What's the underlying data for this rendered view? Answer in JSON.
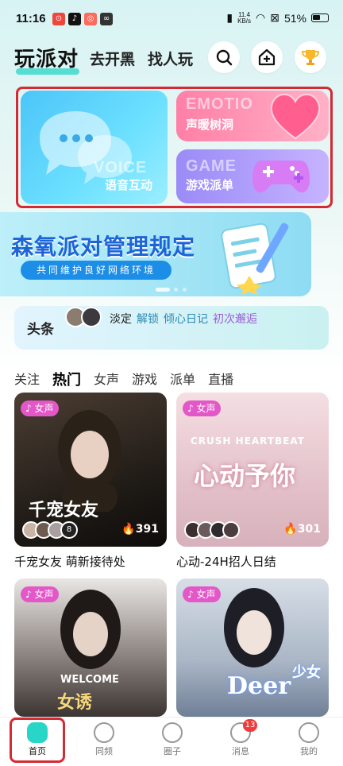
{
  "status_bar": {
    "time": "11:16",
    "speed_value": "11.4",
    "speed_unit": "KB/s",
    "battery": "51%"
  },
  "header": {
    "brand": "玩派对",
    "links": [
      "去开黑",
      "找人玩"
    ]
  },
  "features": {
    "voice": {
      "ghost": "VOICE",
      "label": "语音互动"
    },
    "emotion": {
      "ghost": "EMOTIO",
      "label": "声暖树洞"
    },
    "game": {
      "ghost": "GAME",
      "label": "游戏派单"
    }
  },
  "banner": {
    "title": "森氧派对管理规定",
    "subtitle": "共同维护良好网络环境"
  },
  "headline": {
    "label": "头条",
    "tags": [
      "淡定",
      "解锁",
      "倾心日记",
      "初次邂逅"
    ]
  },
  "tabs": [
    "关注",
    "热门",
    "女声",
    "游戏",
    "派单",
    "直播"
  ],
  "rooms": [
    {
      "badge": "女声",
      "count": "391",
      "caption": "千宠女友 萌新接待处",
      "art": "千宠女友",
      "art_sub": "",
      "extra": "8"
    },
    {
      "badge": "女声",
      "count": "301",
      "caption": "心动-24H招人日结",
      "art": "心动予你",
      "art_sub": "CRUSH HEARTBEAT",
      "extra": ""
    },
    {
      "badge": "女声",
      "count": "",
      "caption": "",
      "art": "女诱",
      "art_sub": "WELCOME",
      "extra": ""
    },
    {
      "badge": "女声",
      "count": "",
      "caption": "",
      "art": "Deer",
      "art_sub": "少女",
      "extra": ""
    }
  ],
  "bottom_nav": {
    "items": [
      "首页",
      "同频",
      "圈子",
      "消息",
      "我的"
    ],
    "message_badge": "13"
  },
  "colors": {
    "accent": "#28d6c8",
    "highlight": "#d42a34",
    "tag": "#e457c8"
  }
}
